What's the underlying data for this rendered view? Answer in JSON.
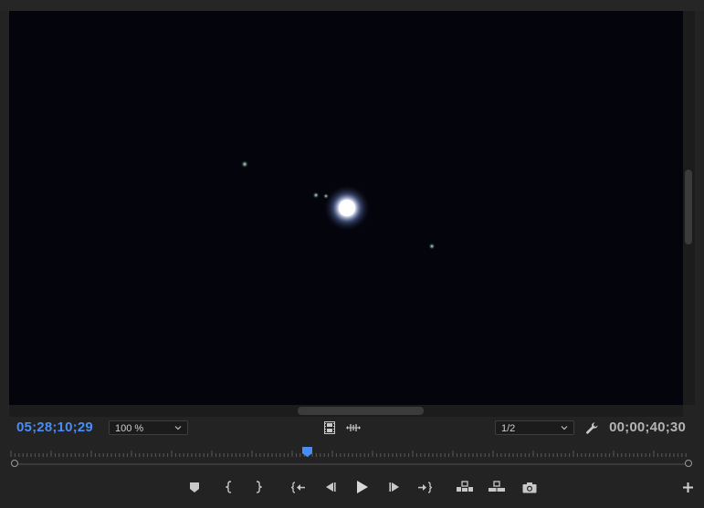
{
  "viewer": {
    "description_icon": "program-monitor-video-frame"
  },
  "timecodes": {
    "current": "05;28;10;29",
    "duration": "00;00;40;30"
  },
  "zoom": {
    "value": "100 %"
  },
  "resolution": {
    "value": "1/2"
  },
  "icons": {
    "settings": "wrench-icon",
    "safe_margins": "film-strip-icon",
    "audio_scrub": "audio-waveform-icon",
    "add_marker": "marker-icon",
    "mark_in": "mark-in-icon",
    "mark_out": "mark-out-icon",
    "go_to_in": "go-to-in-icon",
    "step_back": "step-back-icon",
    "play": "play-icon",
    "step_forward": "step-forward-icon",
    "go_to_out": "go-to-out-icon",
    "lift": "lift-icon",
    "extract": "extract-icon",
    "export_frame": "camera-icon",
    "button_editor": "plus-icon"
  },
  "colors": {
    "current_timecode": "#4a8cf6",
    "playhead": "#4a8cf6",
    "background": "#232323",
    "video": "#02030a"
  },
  "playback": {
    "position_fraction": 0.44
  }
}
